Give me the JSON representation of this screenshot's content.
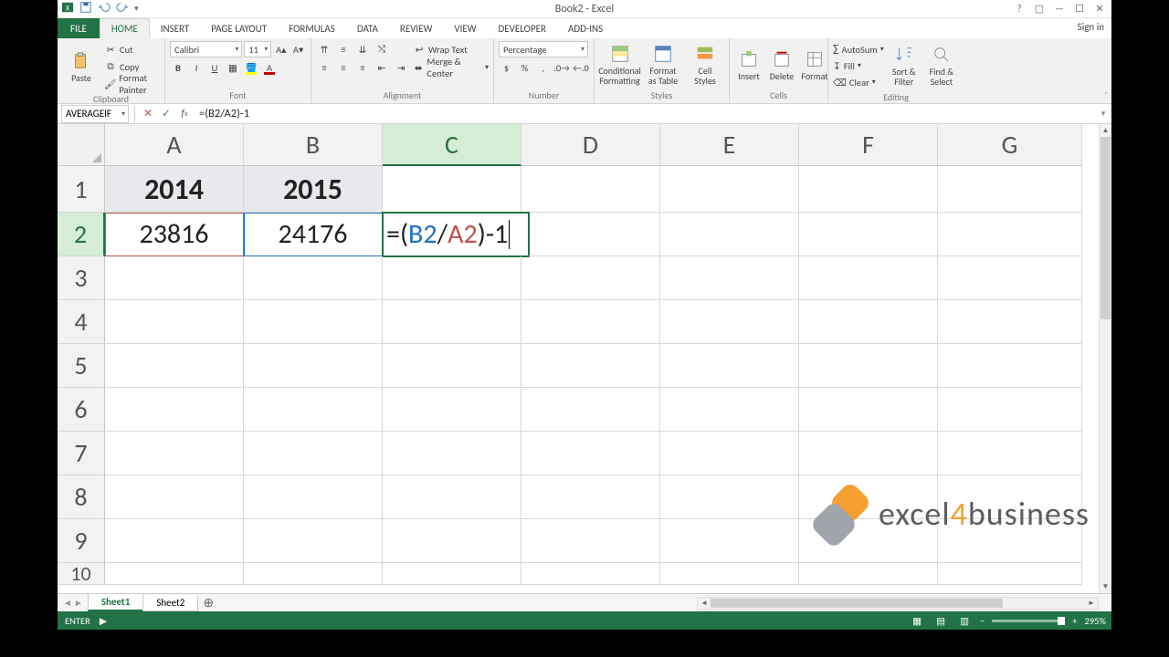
{
  "title": "Book2 - Excel",
  "tabs": {
    "file": "FILE",
    "home": "HOME",
    "insert": "INSERT",
    "pagelayout": "PAGE LAYOUT",
    "formulas": "FORMULAS",
    "data": "DATA",
    "review": "REVIEW",
    "view": "VIEW",
    "developer": "DEVELOPER",
    "addins": "ADD-INS"
  },
  "signin": "Sign in",
  "ribbon": {
    "clipboard": {
      "paste": "Paste",
      "cut": "Cut",
      "copy": "Copy",
      "fp": "Format Painter",
      "label": "Clipboard"
    },
    "font": {
      "name": "Calibri",
      "size": "11",
      "label": "Font"
    },
    "alignment": {
      "wrap": "Wrap Text",
      "merge": "Merge & Center",
      "label": "Alignment"
    },
    "number": {
      "format": "Percentage",
      "label": "Number"
    },
    "styles": {
      "cf": "Conditional Formatting",
      "fat": "Format as Table",
      "cs": "Cell Styles",
      "label": "Styles"
    },
    "cells": {
      "insert": "Insert",
      "delete": "Delete",
      "format": "Format",
      "label": "Cells"
    },
    "editing": {
      "sum": "AutoSum",
      "fill": "Fill",
      "clear": "Clear",
      "sort": "Sort & Filter",
      "find": "Find & Select",
      "label": "Editing"
    }
  },
  "namebox": "AVERAGEIF",
  "formula": "=(B2/A2)-1",
  "colheads": [
    "A",
    "B",
    "C",
    "D",
    "E",
    "F",
    "G"
  ],
  "rownums": [
    "1",
    "2",
    "3",
    "4",
    "5",
    "6",
    "7",
    "8",
    "9",
    "10"
  ],
  "cells": {
    "A1": "2014",
    "B1": "2015",
    "A2": "23816",
    "B2": "24176",
    "C2_parts": {
      "eq": "=(",
      "b": "B2",
      "sl": "/",
      "a": "A2",
      "end": ")-1"
    }
  },
  "sheets": {
    "s1": "Sheet1",
    "s2": "Sheet2"
  },
  "status": {
    "mode": "ENTER",
    "zoom": "295%"
  },
  "watermark": "excel4business",
  "chart_data": {
    "type": "table",
    "columns": [
      "2014",
      "2015"
    ],
    "rows": [
      [
        23816,
        24176
      ]
    ],
    "formula_in_C2": "=(B2/A2)-1",
    "number_format_C": "Percentage"
  }
}
